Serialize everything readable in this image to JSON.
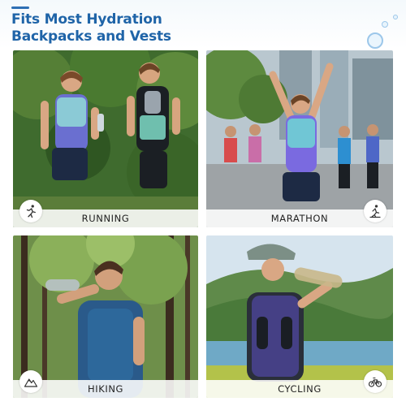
{
  "header": {
    "title_line1": "Fits Most Hydration",
    "title_line2": "Backpacks and Vests"
  },
  "tiles": [
    {
      "label": "RUNNING",
      "icon": "runner-icon"
    },
    {
      "label": "MARATHON",
      "icon": "marathon-runner-icon"
    },
    {
      "label": "HIKING",
      "icon": "mountain-icon"
    },
    {
      "label": "CYCLING",
      "icon": "bicycle-icon"
    }
  ],
  "colors": {
    "title": "#1f64a8",
    "accent": "#2e6fb4",
    "label_text": "#222222"
  }
}
